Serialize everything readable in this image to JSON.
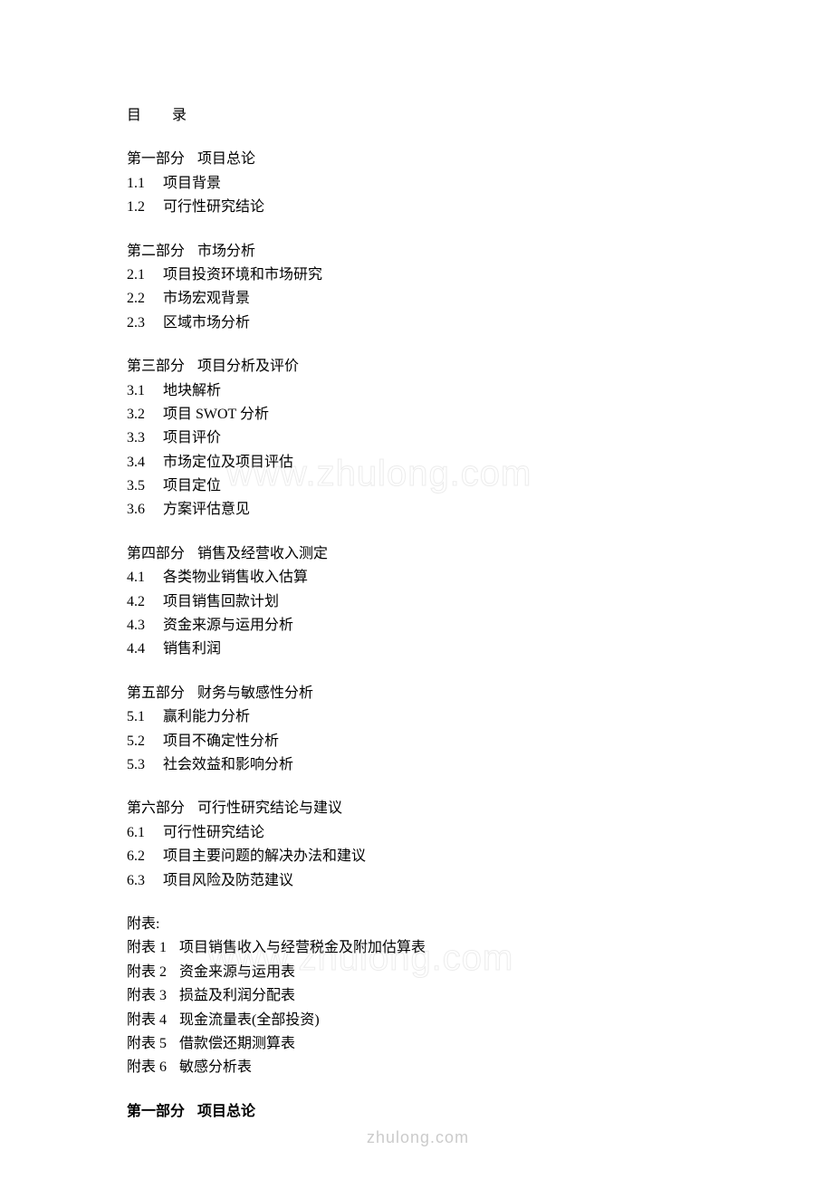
{
  "toc_label_1": "目",
  "toc_label_2": "录",
  "sections": [
    {
      "heading_prefix": "第一部分",
      "heading_title": "项目总论",
      "items": [
        {
          "num": "1.1",
          "text": "项目背景"
        },
        {
          "num": "1.2",
          "text": "可行性研究结论"
        }
      ]
    },
    {
      "heading_prefix": "第二部分",
      "heading_title": "市场分析",
      "items": [
        {
          "num": "2.1",
          "text": "项目投资环境和市场研究"
        },
        {
          "num": "2.2",
          "text": "市场宏观背景"
        },
        {
          "num": "2.3",
          "text": "区域市场分析"
        }
      ]
    },
    {
      "heading_prefix": "第三部分",
      "heading_title": "项目分析及评价",
      "items": [
        {
          "num": "3.1",
          "text": "地块解析"
        },
        {
          "num": "3.2",
          "text": "项目 SWOT 分析"
        },
        {
          "num": "3.3",
          "text": "项目评价"
        },
        {
          "num": "3.4",
          "text": "市场定位及项目评估"
        },
        {
          "num": "3.5",
          "text": "项目定位"
        },
        {
          "num": "3.6",
          "text": "方案评估意见"
        }
      ]
    },
    {
      "heading_prefix": "第四部分",
      "heading_title": "销售及经营收入测定",
      "items": [
        {
          "num": "4.1",
          "text": "各类物业销售收入估算"
        },
        {
          "num": "4.2",
          "text": "项目销售回款计划"
        },
        {
          "num": "4.3",
          "text": "资金来源与运用分析"
        },
        {
          "num": "4.4",
          "text": "销售利润"
        }
      ]
    },
    {
      "heading_prefix": "第五部分",
      "heading_title": "财务与敏感性分析",
      "items": [
        {
          "num": "5.1",
          "text": "赢利能力分析"
        },
        {
          "num": "5.2",
          "text": "项目不确定性分析"
        },
        {
          "num": "5.3",
          "text": "社会效益和影响分析"
        }
      ]
    },
    {
      "heading_prefix": "第六部分",
      "heading_title": "可行性研究结论与建议",
      "items": [
        {
          "num": "6.1",
          "text": "可行性研究结论"
        },
        {
          "num": "6.2",
          "text": "项目主要问题的解决办法和建议"
        },
        {
          "num": "6.3",
          "text": "项目风险及防范建议"
        }
      ]
    }
  ],
  "appendix": {
    "title": "附表:",
    "items": [
      {
        "num": "附表 1",
        "text": "项目销售收入与经营税金及附加估算表"
      },
      {
        "num": "附表 2",
        "text": "资金来源与运用表"
      },
      {
        "num": "附表 3",
        "text": "损益及利润分配表"
      },
      {
        "num": "附表 4",
        "text": "现金流量表(全部投资)"
      },
      {
        "num": "附表 5",
        "text": "借款偿还期测算表"
      },
      {
        "num": "附表 6",
        "text": "敏感分析表"
      }
    ]
  },
  "final": {
    "prefix": "第一部分",
    "title": "项目总论"
  },
  "watermark_large": "www.zhulong.com",
  "watermark_small": "zhulong.com"
}
